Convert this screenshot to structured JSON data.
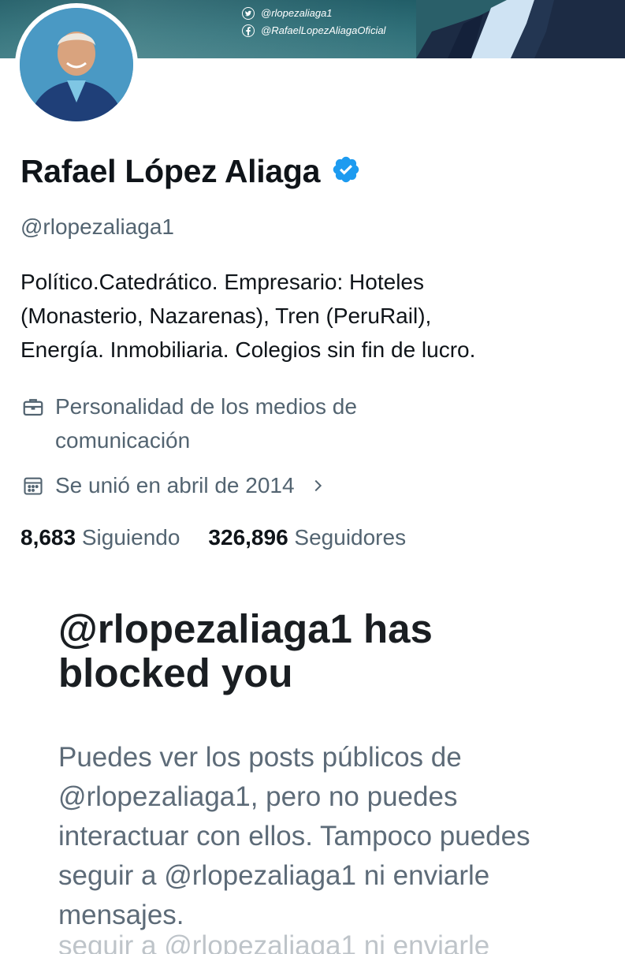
{
  "banner": {
    "twitter_handle": "@rlopezaliaga1",
    "facebook_handle": "@RafaelLopezAliagaOficial"
  },
  "profile": {
    "name": "Rafael López Aliaga",
    "handle": "@rlopezaliaga1",
    "bio_lines": [
      "Político.Catedrático. Empresario: Hoteles",
      "(Monasterio, Nazarenas), Tren (PeruRail),",
      "Energía. Inmobiliaria. Colegios sin fin de lucro."
    ],
    "category_lines": [
      "Personalidad de los medios de",
      "comunicación"
    ],
    "joined": "Se unió en abril de 2014",
    "following_count": "8,683",
    "following_label": "Siguiendo",
    "followers_count": "326,896",
    "followers_label": "Seguidores"
  },
  "blocked": {
    "title_lines": [
      "@rlopezaliaga1 has",
      "blocked you"
    ],
    "message_lines": [
      "Puedes ver los posts públicos de",
      "@rlopezaliaga1, pero no puedes",
      "interactuar con ellos. Tampoco puedes",
      "seguir a @rlopezaliaga1 ni enviarle",
      "mensajes."
    ],
    "cut_line": "seguir a @rlopezaliaga1 ni enviarle"
  },
  "colors": {
    "verified": "#1d9bf0",
    "secondary_text": "#536471",
    "banner": "#2e6f78"
  }
}
